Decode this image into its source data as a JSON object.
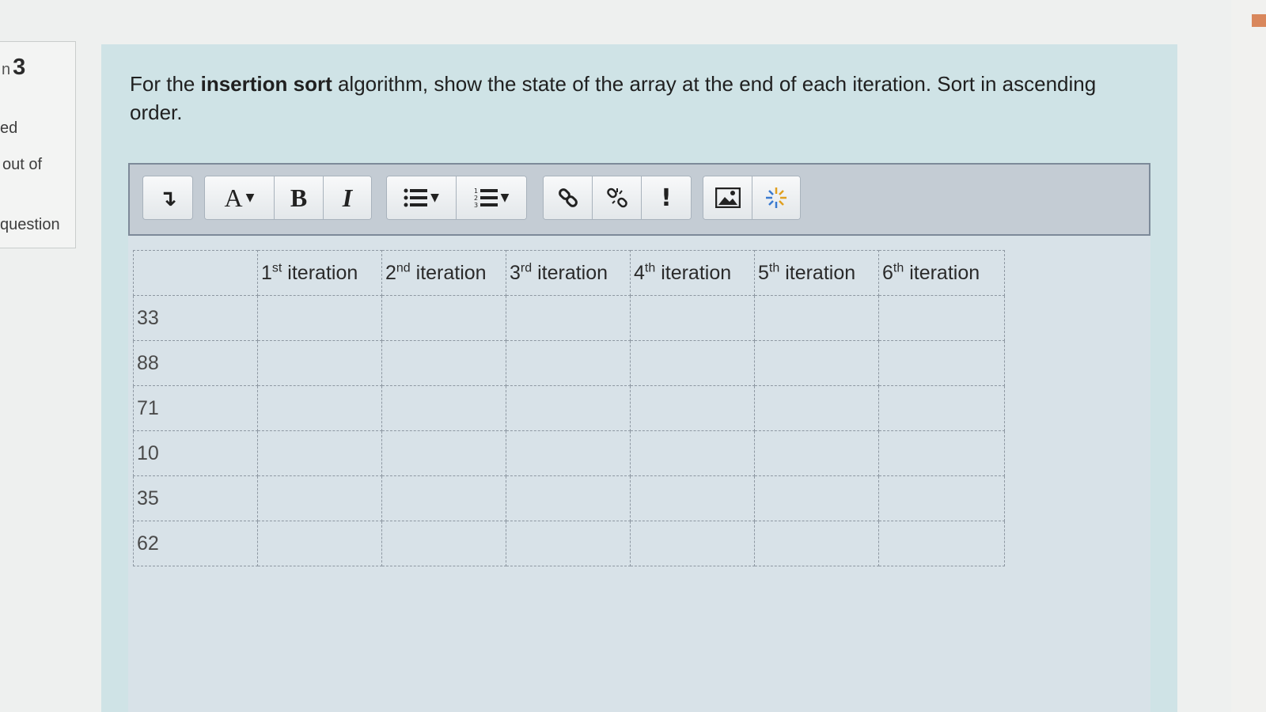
{
  "info": {
    "question_number": "3",
    "question_prefix": "n",
    "status_text": "ed",
    "marks_text": "out of",
    "flag_text": "question"
  },
  "question": {
    "text_before": "For the ",
    "text_bold": "insertion sort",
    "text_after": " algorithm, show the state of the array at the end of each iteration. Sort in ascending order."
  },
  "toolbar": {
    "buttons": [
      {
        "name": "expand-toolbar",
        "label": "↴"
      },
      {
        "name": "text-format",
        "label": "A"
      },
      {
        "name": "bold",
        "label": "B"
      },
      {
        "name": "italic",
        "label": "I"
      },
      {
        "name": "unordered-list",
        "label": ""
      },
      {
        "name": "ordered-list",
        "label": ""
      },
      {
        "name": "link",
        "label": ""
      },
      {
        "name": "unlink",
        "label": ""
      },
      {
        "name": "emoji-warning",
        "label": "!"
      },
      {
        "name": "image",
        "label": ""
      },
      {
        "name": "media",
        "label": ""
      }
    ]
  },
  "table": {
    "headers": [
      {
        "num": "",
        "sup": "",
        "label": ""
      },
      {
        "num": "1",
        "sup": "st",
        "label": " iteration"
      },
      {
        "num": "2",
        "sup": "nd",
        "label": " iteration"
      },
      {
        "num": "3",
        "sup": "rd",
        "label": " iteration"
      },
      {
        "num": "4",
        "sup": "th",
        "label": " iteration"
      },
      {
        "num": "5",
        "sup": "th",
        "label": " iteration"
      },
      {
        "num": "6",
        "sup": "th",
        "label": " iteration"
      }
    ],
    "rows": [
      "33",
      "88",
      "71",
      "10",
      "35",
      "62"
    ]
  }
}
